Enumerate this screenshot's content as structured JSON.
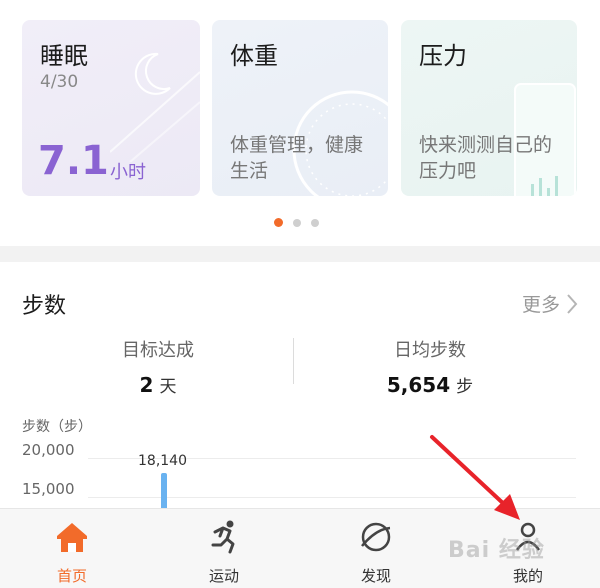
{
  "cards": [
    {
      "title": "睡眠",
      "date": "4/30",
      "value": "7.1",
      "unit": "小时"
    },
    {
      "title": "体重",
      "desc": "体重管理，健康生活"
    },
    {
      "title": "压力",
      "desc": "快来测测自己的压力吧"
    }
  ],
  "carousel": {
    "page_count": 3,
    "active_index": 0
  },
  "steps": {
    "title": "步数",
    "more_label": "更多",
    "goal_label": "目标达成",
    "goal_value": "2",
    "goal_unit": "天",
    "avg_label": "日均步数",
    "avg_value": "5,654",
    "avg_unit": "步"
  },
  "chart_data": {
    "type": "bar",
    "ylabel": "步数（步）",
    "yticks": [
      "20,000",
      "15,000"
    ],
    "ytick_values": [
      20000,
      15000
    ],
    "values": [
      18140
    ],
    "data_labels": [
      "18,140"
    ]
  },
  "bottom_nav": [
    {
      "label": "首页",
      "icon": "home-icon",
      "active": true
    },
    {
      "label": "运动",
      "icon": "running-icon",
      "active": false
    },
    {
      "label": "发现",
      "icon": "planet-icon",
      "active": false
    },
    {
      "label": "我的",
      "icon": "profile-icon",
      "active": false
    }
  ],
  "watermark_text": "Bai 经验",
  "colors": {
    "accent": "#f26b2a",
    "sleep": "#8a63d2",
    "bar": "#69b2f0",
    "arrow": "#e8232a"
  }
}
